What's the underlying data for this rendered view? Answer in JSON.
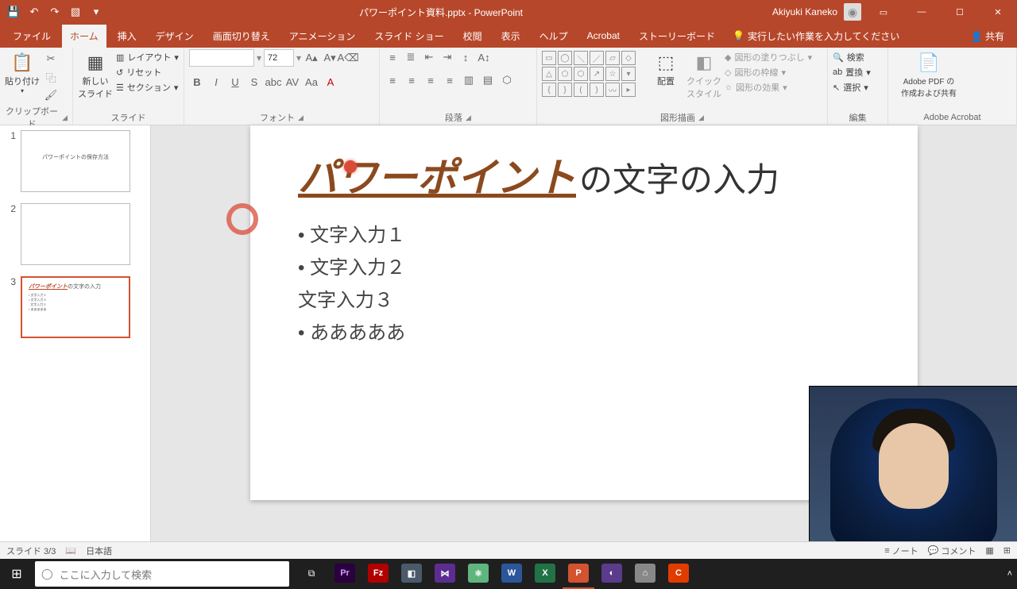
{
  "title_bar": {
    "document_title": "パワーポイント資料.pptx - PowerPoint",
    "user_name": "Akiyuki Kaneko"
  },
  "ribbon_tabs": {
    "file": "ファイル",
    "home": "ホーム",
    "insert": "挿入",
    "design": "デザイン",
    "transitions": "画面切り替え",
    "animations": "アニメーション",
    "slideshow": "スライド ショー",
    "review": "校閲",
    "view": "表示",
    "help": "ヘルプ",
    "acrobat": "Acrobat",
    "storyboard": "ストーリーボード",
    "tell_me": "実行したい作業を入力してください",
    "share": "共有"
  },
  "ribbon_groups": {
    "clipboard": {
      "label": "クリップボード",
      "paste": "貼り付け"
    },
    "slides": {
      "label": "スライド",
      "new_slide": "新しい\nスライド",
      "layout": "レイアウト",
      "reset": "リセット",
      "section": "セクション"
    },
    "font": {
      "label": "フォント",
      "size": "72"
    },
    "paragraph": {
      "label": "段落"
    },
    "drawing": {
      "label": "図形描画",
      "arrange": "配置",
      "quick_styles": "クイック\nスタイル",
      "fill": "図形の塗りつぶし",
      "outline": "図形の枠線",
      "effects": "図形の効果"
    },
    "editing": {
      "label": "編集",
      "find": "検索",
      "replace": "置換",
      "select": "選択"
    },
    "acrobat_group": {
      "label": "Adobe Acrobat",
      "create_pdf": "Adobe PDF の\n作成および共有"
    }
  },
  "thumbnails": [
    {
      "n": "1",
      "title_accent": "",
      "title_rest": "パワーポイントの保存方法"
    },
    {
      "n": "2",
      "title_accent": "",
      "title_rest": ""
    },
    {
      "n": "3",
      "title_accent": "パワーポイント",
      "title_rest": "の文字の入力"
    }
  ],
  "current_slide": {
    "title_accent": "パワーポイント",
    "title_rest": "の文字の入力",
    "bullets": [
      {
        "text": "文字入力１",
        "bullet": true
      },
      {
        "text": "文字入力２",
        "bullet": true
      },
      {
        "text": "文字入力３",
        "bullet": false
      },
      {
        "text": "あああああ",
        "bullet": true
      }
    ]
  },
  "status_bar": {
    "slide_pos": "スライド 3/3",
    "language": "日本語",
    "notes": "ノート",
    "comments": "コメント"
  },
  "taskbar": {
    "search_placeholder": "ここに入力して検索"
  }
}
